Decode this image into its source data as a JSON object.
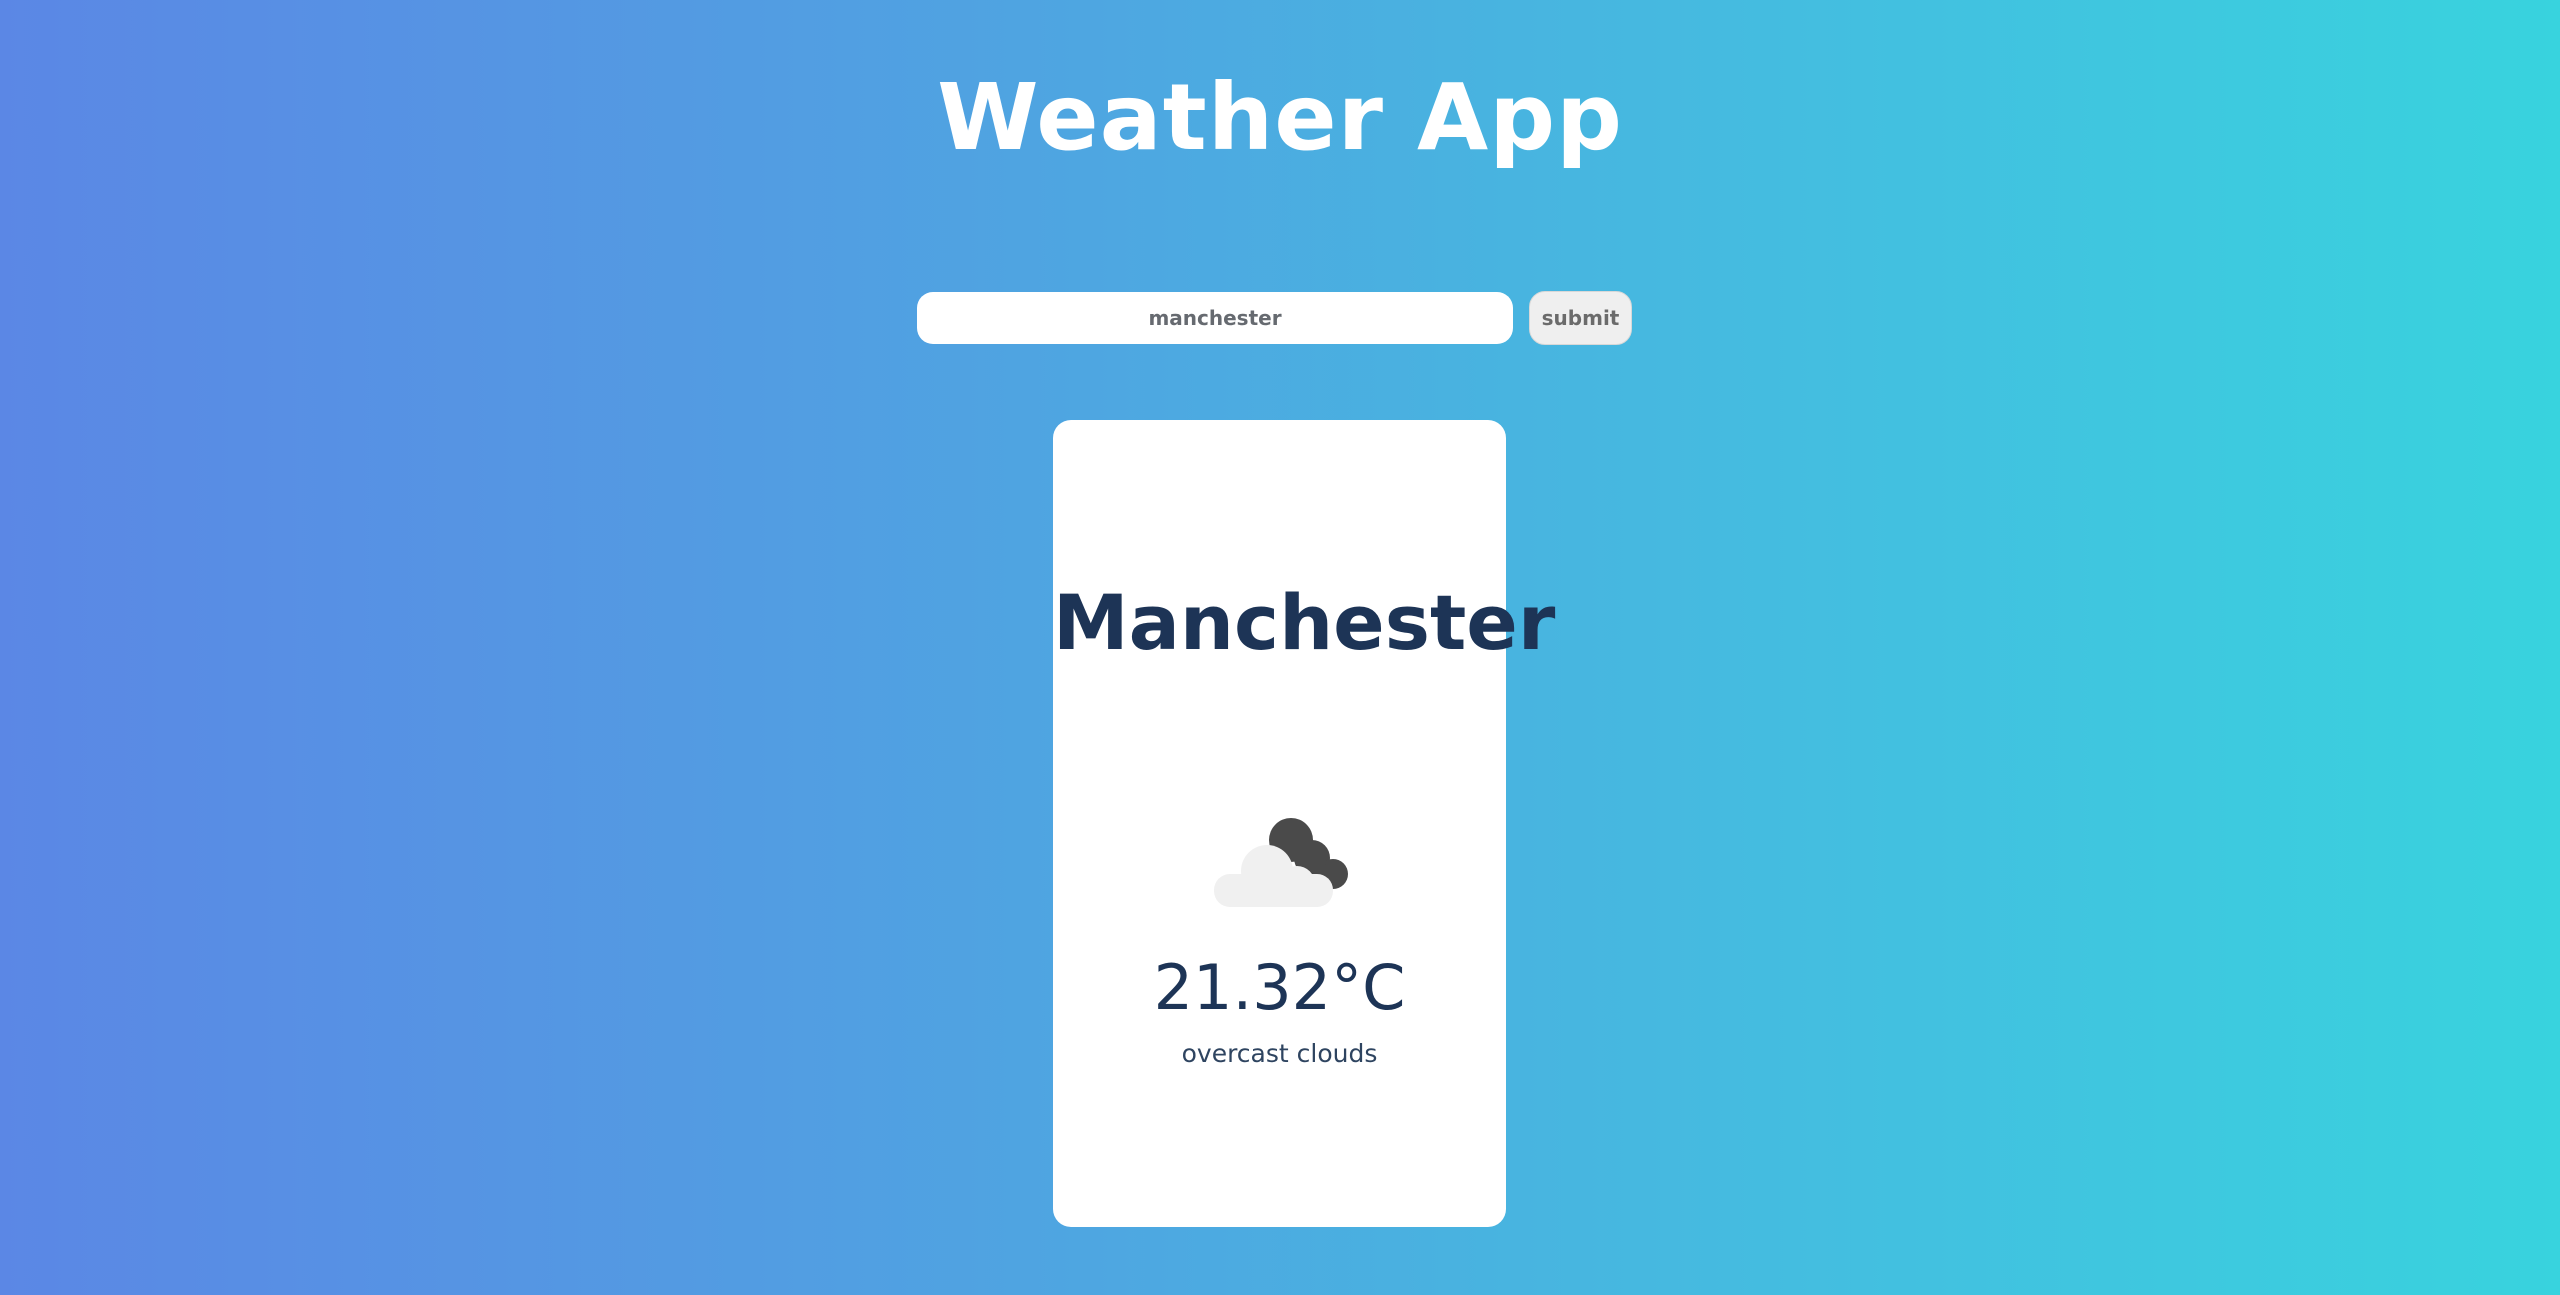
{
  "app": {
    "title": "Weather App"
  },
  "search": {
    "value": "manchester",
    "submit_label": "submit"
  },
  "weather": {
    "city": "Manchester",
    "temperature": "21.32°C",
    "description": "overcast clouds",
    "icon": "overcast-clouds-icon"
  },
  "colors": {
    "background_start": "#5b87e5",
    "background_end": "#38d3de",
    "card_background": "#ffffff",
    "text_dark": "#1d3456",
    "cloud_light": "#f0f0f0",
    "cloud_dark": "#4a4a4a"
  }
}
